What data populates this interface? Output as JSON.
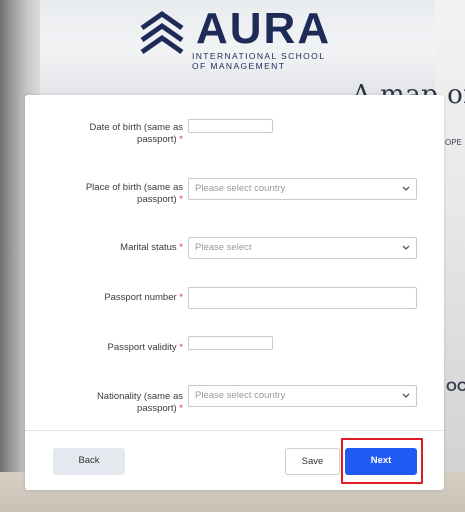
{
  "brand": {
    "name": "AURA",
    "subtitle_line1": "INTERNATIONAL SCHOOL",
    "subtitle_line2": "OF MANAGEMENT",
    "color": "#1e2a58"
  },
  "background": {
    "wall_text": "A map of the",
    "wall_snippet_1": "OPE",
    "wall_snippet_2": "OCEA"
  },
  "form": {
    "required_mark": "*",
    "fields": [
      {
        "label_line1": "Date of birth (same as",
        "label_line2": "passport)",
        "type": "date",
        "value": ""
      },
      {
        "label_line1": "Place of birth (same as",
        "label_line2": "passport)",
        "type": "select",
        "placeholder": "Please select country"
      },
      {
        "label_line1": "Marital status",
        "label_line2": "",
        "type": "select",
        "placeholder": "Please select"
      },
      {
        "label_line1": "Passport number",
        "label_line2": "",
        "type": "text",
        "value": ""
      },
      {
        "label_line1": "Passport validity",
        "label_line2": "",
        "type": "date",
        "value": ""
      },
      {
        "label_line1": "Nationality (same as",
        "label_line2": "passport)",
        "type": "select",
        "placeholder": "Please select country"
      }
    ]
  },
  "actions": {
    "back_label": "Back",
    "save_label": "Save",
    "next_label": "Next",
    "accent_color": "#1f5bf2",
    "highlight_color": "#e01b24"
  }
}
